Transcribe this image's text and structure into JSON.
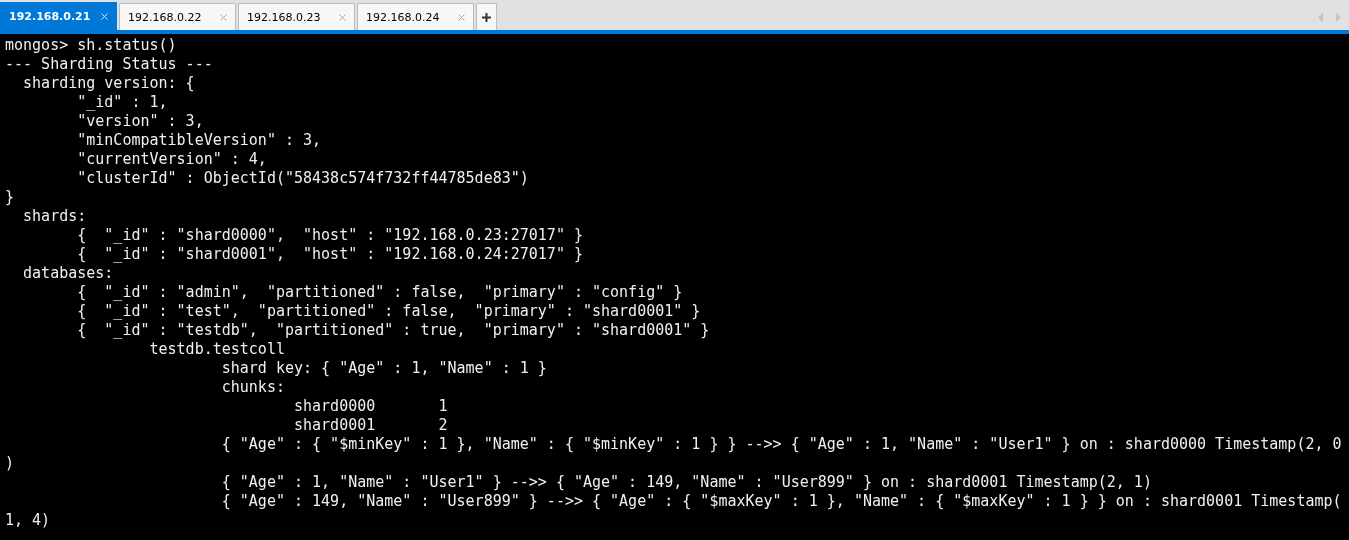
{
  "tabs": [
    {
      "label": "192.168.0.21",
      "selected": true
    },
    {
      "label": "192.168.0.22",
      "selected": false
    },
    {
      "label": "192.168.0.23",
      "selected": false
    },
    {
      "label": "192.168.0.24",
      "selected": false
    }
  ],
  "terminal": {
    "lines": [
      "mongos> sh.status()",
      "--- Sharding Status ---",
      "  sharding version: {",
      "        \"_id\" : 1,",
      "        \"version\" : 3,",
      "        \"minCompatibleVersion\" : 3,",
      "        \"currentVersion\" : 4,",
      "        \"clusterId\" : ObjectId(\"58438c574f732ff44785de83\")",
      "}",
      "  shards:",
      "        {  \"_id\" : \"shard0000\",  \"host\" : \"192.168.0.23:27017\" }",
      "        {  \"_id\" : \"shard0001\",  \"host\" : \"192.168.0.24:27017\" }",
      "  databases:",
      "        {  \"_id\" : \"admin\",  \"partitioned\" : false,  \"primary\" : \"config\" }",
      "        {  \"_id\" : \"test\",  \"partitioned\" : false,  \"primary\" : \"shard0001\" }",
      "        {  \"_id\" : \"testdb\",  \"partitioned\" : true,  \"primary\" : \"shard0001\" }",
      "                testdb.testcoll",
      "                        shard key: { \"Age\" : 1, \"Name\" : 1 }",
      "                        chunks:",
      "                                shard0000       1",
      "                                shard0001       2",
      "                        { \"Age\" : { \"$minKey\" : 1 }, \"Name\" : { \"$minKey\" : 1 } } -->> { \"Age\" : 1, \"Name\" : \"User1\" } on : shard0000 Timestamp(2, 0",
      ")",
      "                        { \"Age\" : 1, \"Name\" : \"User1\" } -->> { \"Age\" : 149, \"Name\" : \"User899\" } on : shard0001 Timestamp(2, 1)",
      "                        { \"Age\" : 149, \"Name\" : \"User899\" } -->> { \"Age\" : { \"$maxKey\" : 1 }, \"Name\" : { \"$maxKey\" : 1 } } on : shard0001 Timestamp(",
      "1, 4)"
    ]
  }
}
